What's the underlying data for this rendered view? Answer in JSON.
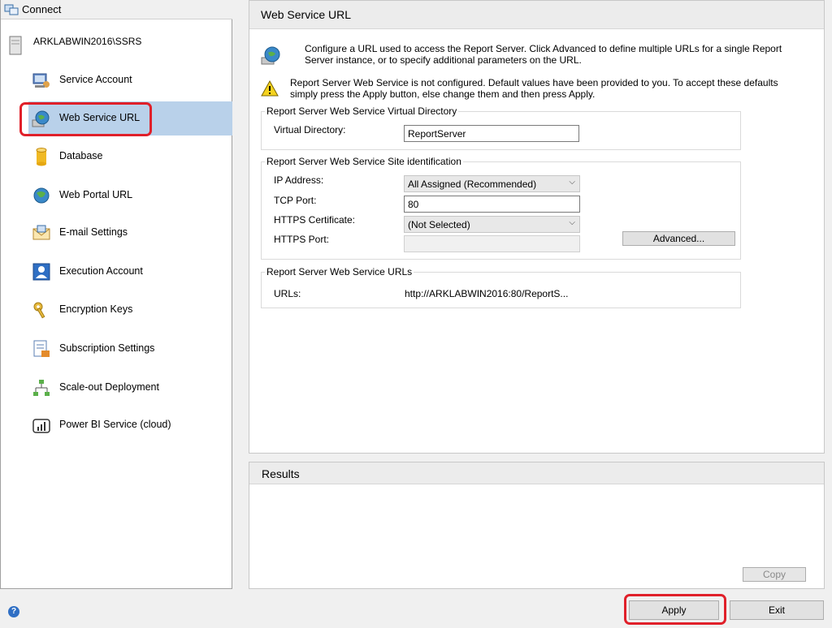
{
  "connect": {
    "label": "Connect",
    "icon": "connect-icon"
  },
  "server": {
    "name": "ARKLABWIN2016\\SSRS",
    "icon": "server-icon"
  },
  "nav": {
    "items": [
      {
        "label": "Service Account",
        "icon": "service-account-icon"
      },
      {
        "label": "Web Service URL",
        "icon": "web-service-globe-icon",
        "selected": true
      },
      {
        "label": "Database",
        "icon": "database-icon"
      },
      {
        "label": "Web Portal URL",
        "icon": "globe-icon"
      },
      {
        "label": "E-mail Settings",
        "icon": "email-icon"
      },
      {
        "label": "Execution Account",
        "icon": "execution-account-icon"
      },
      {
        "label": "Encryption Keys",
        "icon": "keys-icon"
      },
      {
        "label": "Subscription Settings",
        "icon": "subscription-icon"
      },
      {
        "label": "Scale-out Deployment",
        "icon": "scale-out-icon"
      },
      {
        "label": "Power BI Service (cloud)",
        "icon": "power-bi-icon"
      }
    ]
  },
  "main": {
    "title": "Web Service URL",
    "intro": "Configure a URL used to access the Report Server.  Click Advanced to define multiple URLs for a single Report Server instance, or to specify additional parameters on the URL.",
    "warning": "Report Server Web Service is not configured. Default values have been provided to you. To accept these defaults simply press the Apply button, else change them and then press Apply.",
    "virtual_dir": {
      "legend": "Report Server Web Service Virtual Directory",
      "label": "Virtual Directory:",
      "value": "ReportServer"
    },
    "site_id": {
      "legend": "Report Server Web Service Site identification",
      "ip_label": "IP Address:",
      "ip_value": "All Assigned (Recommended)",
      "tcp_label": "TCP Port:",
      "tcp_value": "80",
      "https_cert_label": "HTTPS Certificate:",
      "https_cert_value": "(Not Selected)",
      "https_port_label": "HTTPS Port:",
      "https_port_value": "",
      "advanced_label": "Advanced..."
    },
    "urls": {
      "legend": "Report Server Web Service URLs",
      "label": "URLs:",
      "value": "http://ARKLABWIN2016:80/ReportS..."
    }
  },
  "results": {
    "title": "Results",
    "copy_label": "Copy"
  },
  "footer": {
    "apply_label": "Apply",
    "exit_label": "Exit",
    "help_icon": "help-icon"
  },
  "colors": {
    "selection": "#b9d1ea",
    "annotation": "#e0202a"
  }
}
